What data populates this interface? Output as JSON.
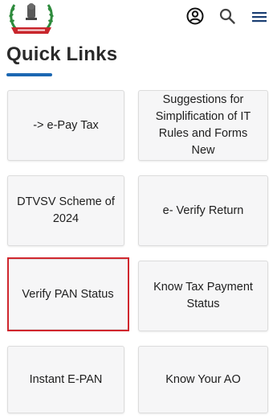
{
  "header": {
    "logo_caption": "INCOME TAX DEPARTMENT",
    "icons": [
      "account-circle-icon",
      "search-icon",
      "hamburger-menu-icon"
    ]
  },
  "section": {
    "title": "Quick Links"
  },
  "cards": [
    {
      "label": "-> e-Pay Tax"
    },
    {
      "label": "Suggestions for Simplification of IT Rules and Forms New"
    },
    {
      "label": "DTVSV Scheme of 2024"
    },
    {
      "label": "e- Verify Return"
    },
    {
      "label": "Verify PAN Status",
      "highlighted": true
    },
    {
      "label": "Know Tax Payment Status"
    },
    {
      "label": "Instant E-PAN"
    },
    {
      "label": "Know Your AO"
    }
  ],
  "colors": {
    "accent_underline": "#1b67b2",
    "highlight_border": "#d0272e",
    "card_bg": "#f6f6f7",
    "logo_green": "#2e8b3d",
    "logo_red": "#c8262c"
  }
}
